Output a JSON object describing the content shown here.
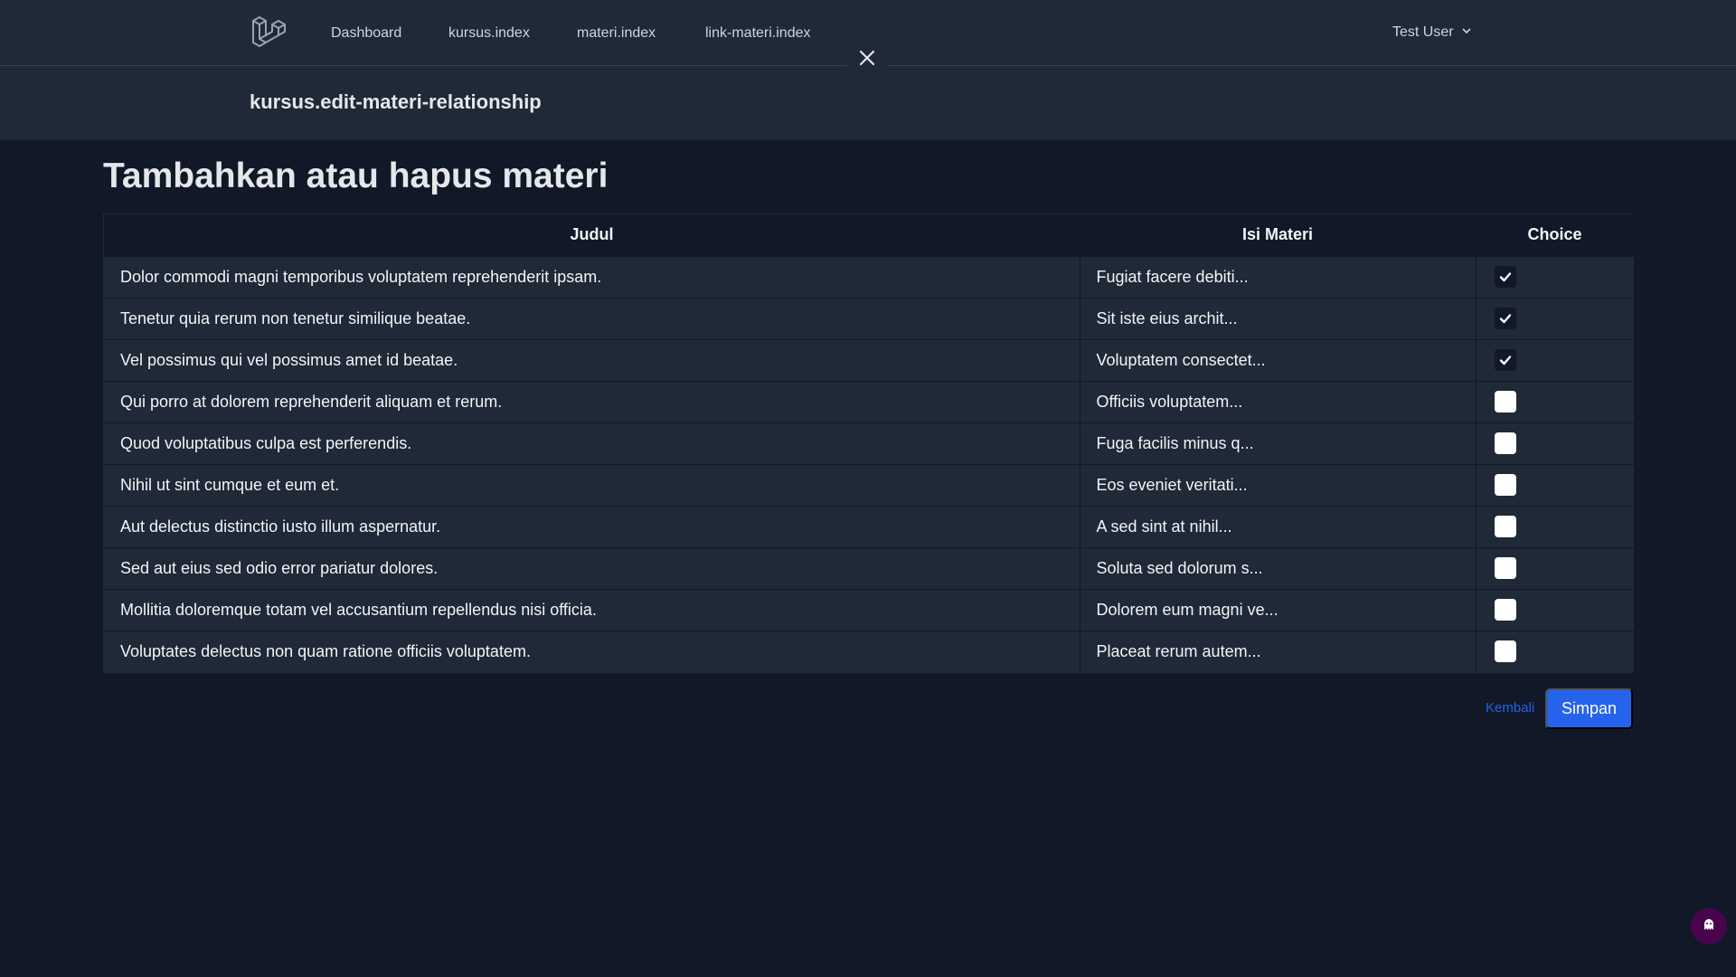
{
  "nav": {
    "logo_icon": "laravel-logo",
    "links": [
      "Dashboard",
      "kursus.index",
      "materi.index",
      "link-materi.index"
    ],
    "user_name": "Test User"
  },
  "header": {
    "title": "kursus.edit-materi-relationship"
  },
  "main": {
    "heading": "Tambahkan atau hapus materi",
    "table": {
      "columns": [
        "Judul",
        "Isi Materi",
        "Choice"
      ],
      "rows": [
        {
          "judul": "Dolor commodi magni temporibus voluptatem reprehenderit ipsam.",
          "isi": "Fugiat facere debiti...",
          "checked": true
        },
        {
          "judul": "Tenetur quia rerum non tenetur similique beatae.",
          "isi": "Sit iste eius archit...",
          "checked": true
        },
        {
          "judul": "Vel possimus qui vel possimus amet id beatae.",
          "isi": "Voluptatem consectet...",
          "checked": true
        },
        {
          "judul": "Qui porro at dolorem reprehenderit aliquam et rerum.",
          "isi": "Officiis voluptatem...",
          "checked": false
        },
        {
          "judul": "Quod voluptatibus culpa est perferendis.",
          "isi": "Fuga facilis minus q...",
          "checked": false
        },
        {
          "judul": "Nihil ut sint cumque et eum et.",
          "isi": "Eos eveniet veritati...",
          "checked": false
        },
        {
          "judul": "Aut delectus distinctio iusto illum aspernatur.",
          "isi": "A sed sint at nihil...",
          "checked": false
        },
        {
          "judul": "Sed aut eius sed odio error pariatur dolores.",
          "isi": "Soluta sed dolorum s...",
          "checked": false
        },
        {
          "judul": "Mollitia doloremque totam vel accusantium repellendus nisi officia.",
          "isi": "Dolorem eum magni ve...",
          "checked": false
        },
        {
          "judul": "Voluptates delectus non quam ratione officiis voluptatem.",
          "isi": "Placeat rerum autem...",
          "checked": false
        }
      ]
    },
    "actions": {
      "back_label": "Kembali",
      "save_label": "Simpan"
    }
  },
  "colors": {
    "background": "#111827",
    "panel": "#1f2937",
    "accent": "#2563eb",
    "debug_badge": "#4a044e"
  }
}
